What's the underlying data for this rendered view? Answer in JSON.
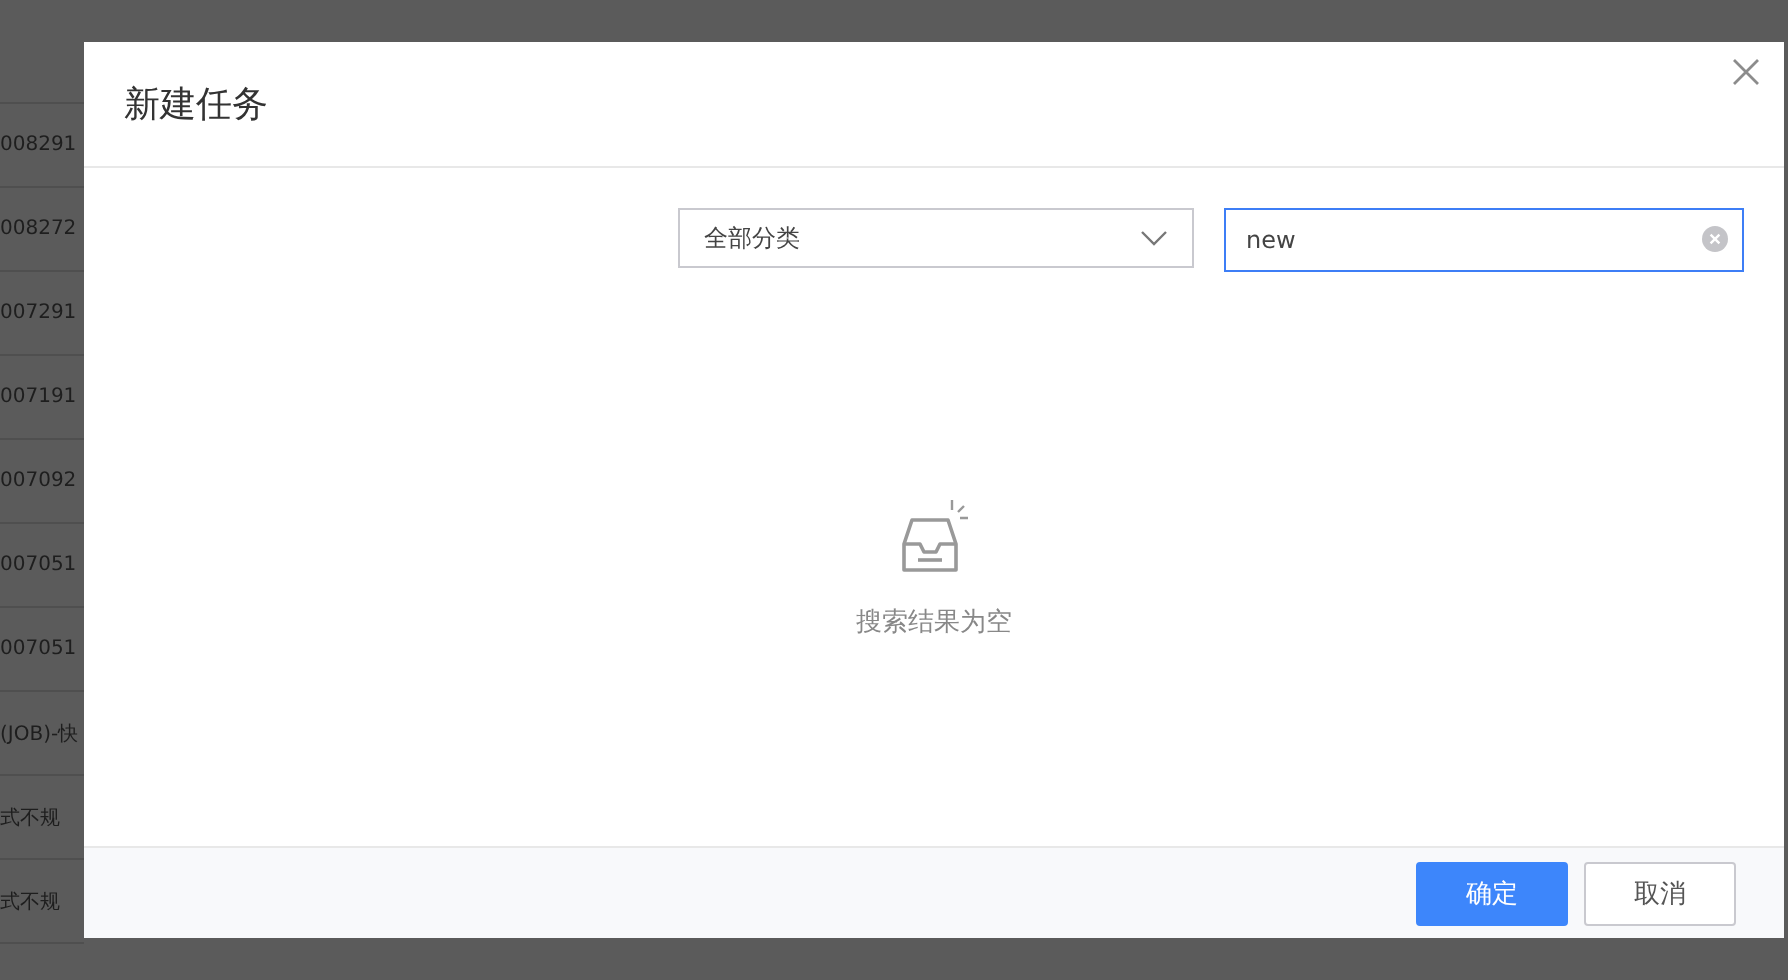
{
  "background_rows": [
    "008291",
    "008272",
    "007291",
    "007191",
    "007092",
    "007051",
    "007051",
    "(JOB)-快",
    "式不规",
    "式不规"
  ],
  "dialog": {
    "title": "新建任务",
    "category_select": {
      "value": "全部分类"
    },
    "search": {
      "value": "new"
    },
    "empty_message": "搜索结果为空",
    "buttons": [
      {
        "label": "确定",
        "kind": "primary"
      },
      {
        "label": "取消",
        "kind": "default"
      }
    ]
  }
}
